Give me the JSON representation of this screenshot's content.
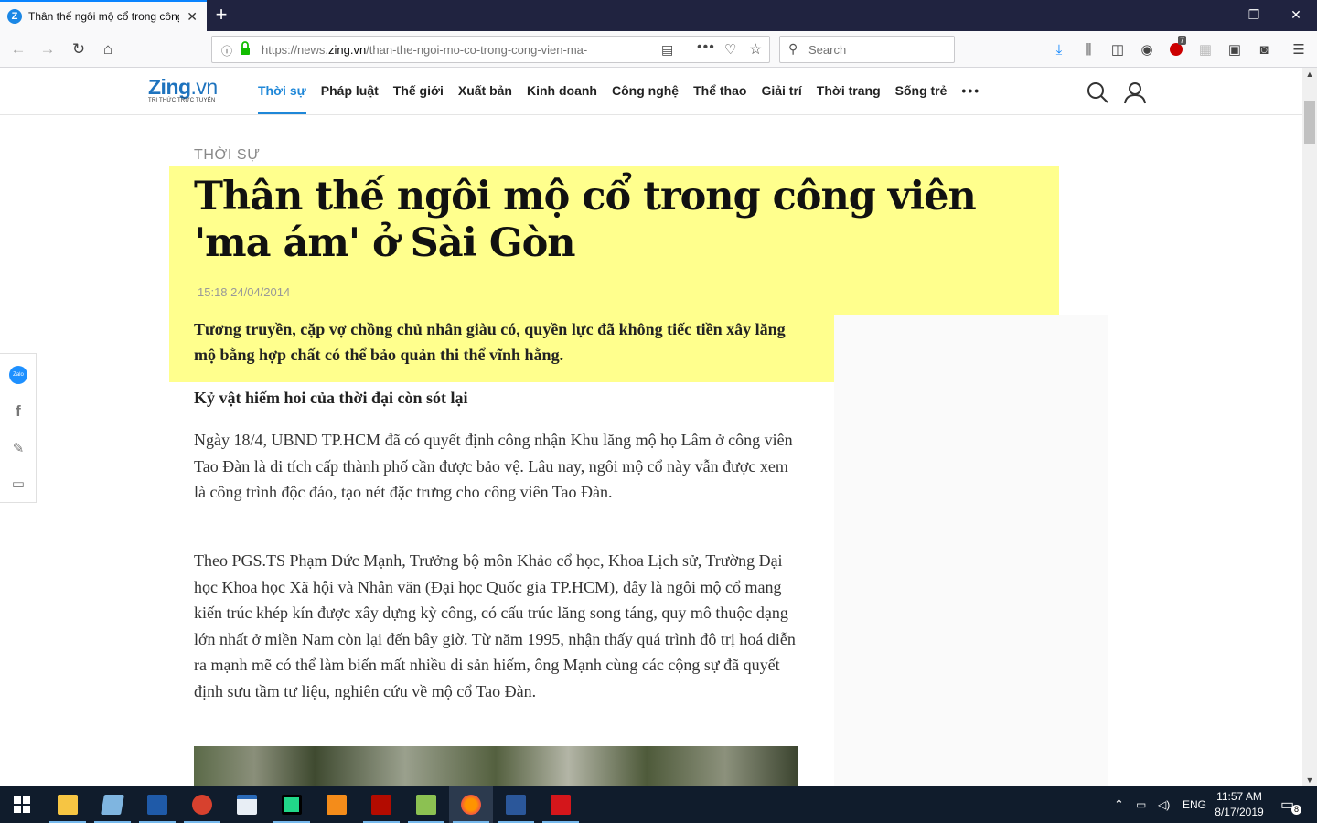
{
  "browser": {
    "tab_title": "Thân thế ngôi mộ cổ trong công viên 'ma ám' ở Sài Gòn",
    "tab_favicon": "Z",
    "url_prefix": "https://news.",
    "url_domain": "zing.vn",
    "url_path": "/than-the-ngoi-mo-co-trong-cong-vien-ma-",
    "search_placeholder": "Search",
    "addon_badge": "7"
  },
  "site": {
    "logo_main": "Zing",
    "logo_suffix": ".vn",
    "logo_tagline": "TRI THỨC TRỰC TUYẾN",
    "menu": [
      "Thời sự",
      "Pháp luật",
      "Thế giới",
      "Xuất bản",
      "Kinh doanh",
      "Công nghệ",
      "Thể thao",
      "Giải trí",
      "Thời trang",
      "Sống trẻ"
    ],
    "more": "•••"
  },
  "article": {
    "category": "THỜI SỰ",
    "title": "Thân thế ngôi mộ cổ trong công viên 'ma ám' ở Sài Gòn",
    "time": "15:18 24/04/2014",
    "sapo": "Tương truyền, cặp vợ chồng chủ nhân giàu có, quyền lực đã không tiếc tiền xây lăng mộ bằng hợp chất có thể bảo quản thi thể vĩnh hằng.",
    "subheading": "Kỷ vật hiếm hoi của thời đại còn sót lại",
    "paragraph1": "Ngày 18/4, UBND TP.HCM đã có quyết định công nhận Khu lăng mộ họ Lâm ở công viên Tao Đàn là di tích cấp thành phố cần được bảo vệ. Lâu nay, ngôi mộ cổ này vẫn được xem là công trình độc đáo, tạo nét đặc trưng cho công viên Tao Đàn.",
    "paragraph2": "Theo PGS.TS Phạm Đức Mạnh, Trưởng bộ môn Khảo cổ học, Khoa Lịch sử, Trường Đại học Khoa học Xã hội và Nhân văn (Đại học Quốc gia TP.HCM), đây là ngôi mộ cổ mang kiến trúc khép kín được xây dựng kỳ công, có cấu trúc lăng song táng, quy mô thuộc dạng lớn nhất ở miền Nam còn lại đến bây giờ. Từ năm 1995, nhận thấy quá trình đô trị hoá diễn ra mạnh mẽ có thể làm biến mất nhiều di sản hiếm, ông Mạnh cùng các cộng sự đã quyết định sưu tầm tư liệu, nghiên cứu về mộ cổ Tao Đàn."
  },
  "share": {
    "zalo_label": "Zalo"
  },
  "taskbar": {
    "lang": "ENG",
    "time": "11:57 AM",
    "date": "8/17/2019",
    "notif_count": "8"
  },
  "colors": {
    "accent": "#1e87d8",
    "highlight": "#ffff8d",
    "titlebar": "#202340",
    "taskbar": "#101c2c"
  }
}
